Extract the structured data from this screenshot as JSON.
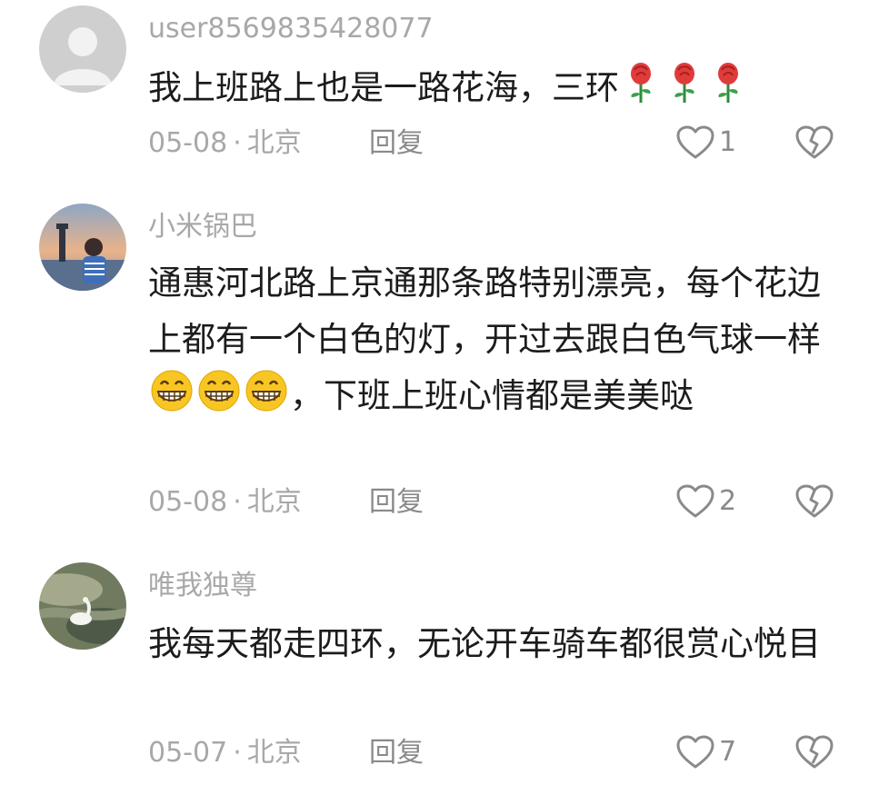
{
  "comments": [
    {
      "username": "user8569835428077",
      "avatar": "default-avatar",
      "content_before": "我上班路上也是一路花海，三环",
      "content_emoji": "rose-emoji x3",
      "content_after": "",
      "date": "05-08",
      "separator": "·",
      "location": "北京",
      "reply_label": "回复",
      "like_count": "1"
    },
    {
      "username": "小米锅巴",
      "avatar": "sunset-lighthouse-photo",
      "content_before": "通惠河北路上京通那条路特别漂亮，每个花边上都有一个白色的灯，开过去跟白色气球一样",
      "content_emoji": "grinning-face-emoji x3",
      "content_after": "，下班上班心情都是美美哒",
      "date": "05-08",
      "separator": "·",
      "location": "北京",
      "reply_label": "回复",
      "like_count": "2"
    },
    {
      "username": "唯我独尊",
      "avatar": "swan-on-water-photo",
      "content_before": "我每天都走四环，无论开车骑车都很赏心悦目",
      "content_emoji": "",
      "content_after": "",
      "date": "05-07",
      "separator": "·",
      "location": "北京",
      "reply_label": "回复",
      "like_count": "7"
    }
  ],
  "colors": {
    "text": "#1c1c1c",
    "muted": "#a8a8a8",
    "action": "#8a8a8a"
  }
}
